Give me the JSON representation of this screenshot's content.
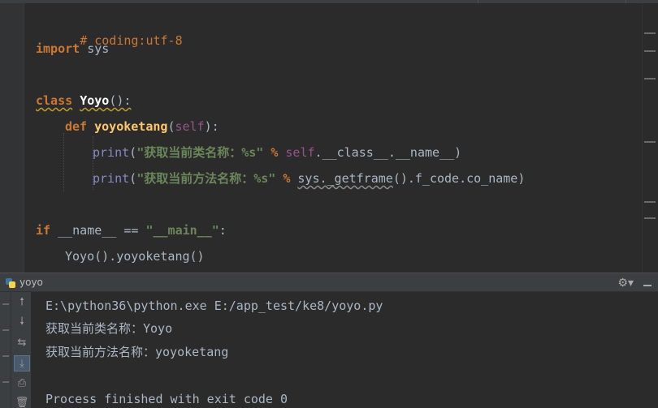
{
  "editor": {
    "lines": [
      "# coding:utf-8",
      "import",
      "sys",
      "class",
      "Yoyo",
      "():",
      "def",
      "yoyoketang",
      "self",
      "print",
      "\"获取当前类名称：%s\"",
      "%",
      "self",
      ".__class__.__name__)",
      "\"获取当前方法名称：%s\"",
      "sys",
      "._getframe",
      "().f_code.co_name)",
      "if",
      "__name__",
      "==",
      "\"__main__\"",
      "Yoyo",
      "().yoyoketang()"
    ]
  },
  "run_panel": {
    "title": "yoyo",
    "console_lines": [
      "E:\\python36\\python.exe E:/app_test/ke8/yoyo.py",
      "获取当前类名称：Yoyo",
      "获取当前方法名称：yoyoketang",
      "Process finished with exit code 0"
    ]
  },
  "icons": {
    "gear": "gear-icon",
    "minimize": "minimize-icon",
    "python": "python-file-icon"
  },
  "colors": {
    "keyword": "#cc7832",
    "string": "#6a8759",
    "function": "#ffc66d",
    "self": "#94558d",
    "builtin": "#8888c6",
    "text": "#a9b7c6",
    "background": "#2b2b2b"
  }
}
